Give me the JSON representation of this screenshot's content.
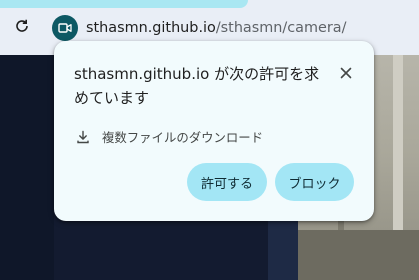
{
  "browser": {
    "reload_icon": "reload-icon",
    "site_info_icon": "camera-icon",
    "url_host": "sthasmn.github.io",
    "url_path": "/sthasmn/camera/"
  },
  "popup": {
    "title": "sthasmn.github.io が次の許可を求めています",
    "close_icon": "close-icon",
    "permission_icon": "download-icon",
    "permission_text": "複数ファイルのダウンロード",
    "allow_label": "許可する",
    "block_label": "ブロック"
  },
  "colors": {
    "popup_bg": "#f2fbfd",
    "button_bg": "#a3e6f5",
    "site_chip": "#0d5964",
    "page_bg": "#131b30"
  }
}
